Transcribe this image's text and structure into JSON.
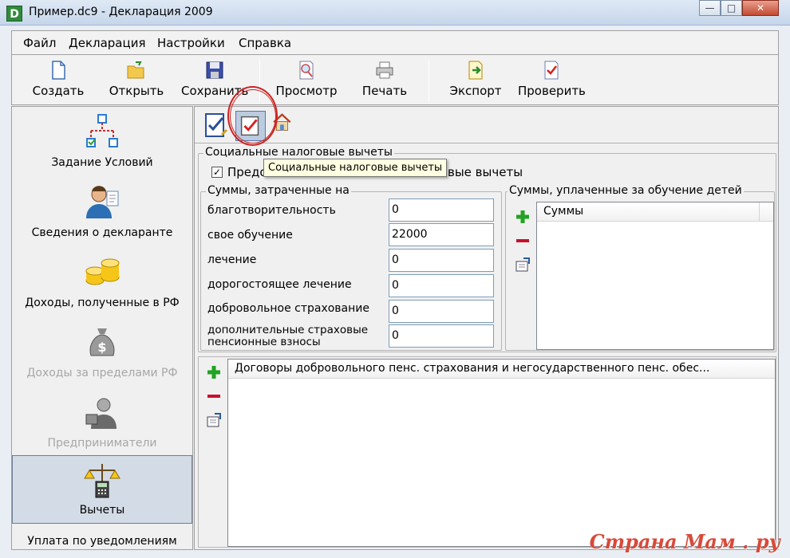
{
  "window": {
    "title": "Пример.dc9 - Декларация 2009",
    "app_icon_letter": "D",
    "minimize": "—",
    "maximize": "□",
    "close": "✕"
  },
  "menu": [
    "Файл",
    "Декларация",
    "Настройки",
    "Справка"
  ],
  "toolbar": [
    {
      "label": "Создать",
      "icon": "new-document-icon"
    },
    {
      "label": "Открыть",
      "icon": "open-folder-icon"
    },
    {
      "label": "Сохранить",
      "icon": "save-disk-icon"
    },
    {
      "label": "Просмотр",
      "icon": "preview-magnifier-icon"
    },
    {
      "label": "Печать",
      "icon": "printer-icon"
    },
    {
      "label": "Экспорт",
      "icon": "export-icon"
    },
    {
      "label": "Проверить",
      "icon": "check-document-icon"
    }
  ],
  "sidebar": [
    {
      "label": "Задание Условий",
      "icon": "conditions-tree-icon",
      "state": "normal"
    },
    {
      "label": "Сведения о декларанте",
      "icon": "person-icon",
      "state": "normal"
    },
    {
      "label": "Доходы, полученные в РФ",
      "icon": "coins-icon",
      "state": "normal"
    },
    {
      "label": "Доходы за пределами РФ",
      "icon": "money-bag-icon",
      "state": "disabled"
    },
    {
      "label": "Предприниматели",
      "icon": "businessman-icon",
      "state": "disabled"
    },
    {
      "label": "Вычеты",
      "icon": "scales-calculator-icon",
      "state": "active"
    },
    {
      "label": "Уплата по уведомлениям",
      "icon": "",
      "state": "normal"
    }
  ],
  "subtoolbar": {
    "tooltip": "Социальные налоговые вычеты"
  },
  "social": {
    "group_title": "Социальные налоговые вычеты",
    "checkbox_checked": true,
    "checkbox_label_visible_start": "Предо",
    "checkbox_label_visible_end": "вые вычеты",
    "sums_title": "Суммы, затраченные на",
    "fields": [
      {
        "label": "благотворительность",
        "value": "0"
      },
      {
        "label": "свое обучение",
        "value": "22000"
      },
      {
        "label": "лечение",
        "value": "0"
      },
      {
        "label": "дорогостоящее лечение",
        "value": "0"
      },
      {
        "label": "добровольное страхование",
        "value": "0"
      },
      {
        "label": "дополнительные страховые пенсионные взносы",
        "value": "0"
      }
    ],
    "children_title": "Суммы, уплаченные за обучение детей",
    "children_column": "Суммы"
  },
  "contracts": {
    "column": "Договоры добровольного пенс. страхования и негосударственного пенс. обес..."
  },
  "watermark": "Страна Мам . ру",
  "colors": {
    "add": "#22a322",
    "remove": "#c8102e",
    "accent_circle": "#cc2222"
  }
}
